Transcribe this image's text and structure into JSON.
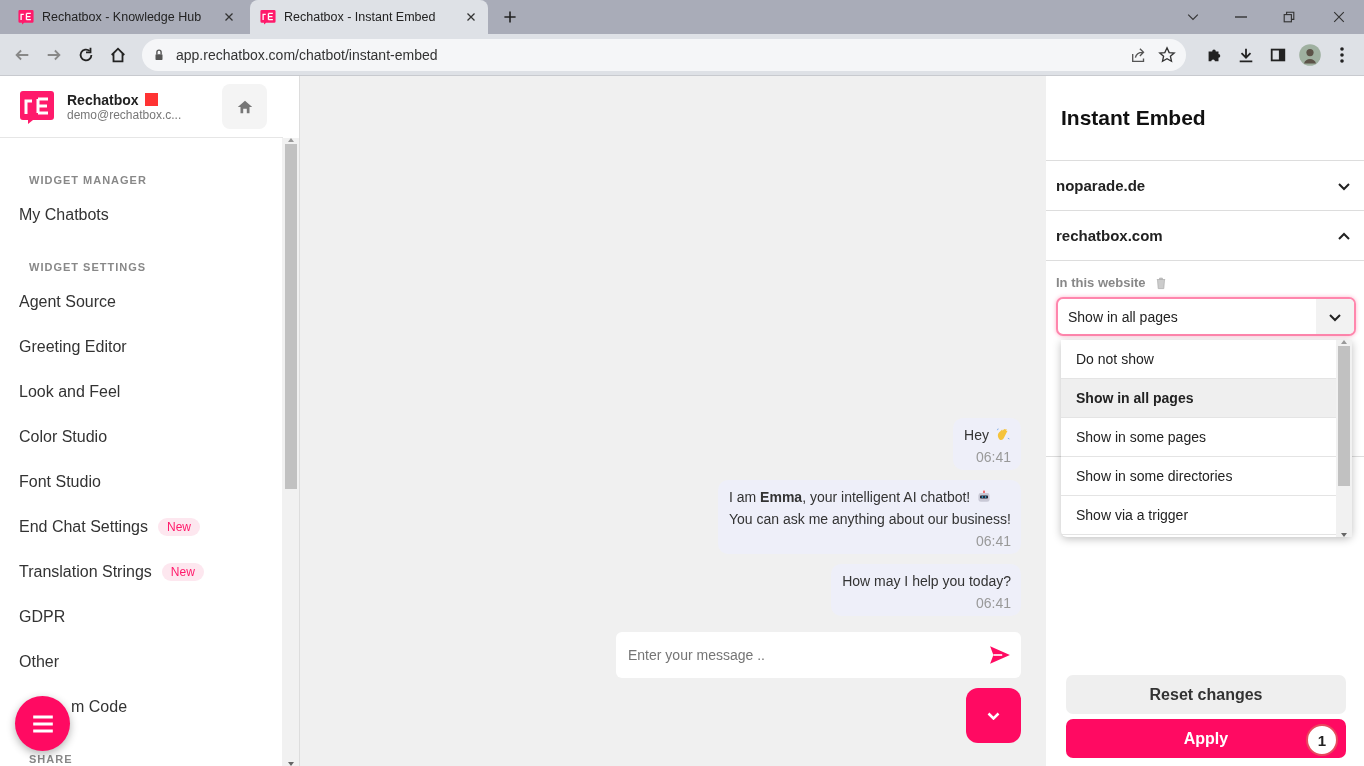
{
  "browser": {
    "tabs": [
      {
        "title": "Rechatbox - Knowledge Hub",
        "selected": false
      },
      {
        "title": "Rechatbox - Instant Embed",
        "selected": true
      }
    ],
    "address": "app.rechatbox.com/chatbot/instant-embed"
  },
  "sidebar": {
    "brand": {
      "name": "Rechatbox",
      "email": "demo@rechatbox.c..."
    },
    "sections": [
      {
        "heading": "WIDGET MANAGER",
        "items": [
          {
            "label": "My Chatbots"
          }
        ]
      },
      {
        "heading": "WIDGET SETTINGS",
        "items": [
          {
            "label": "Agent Source"
          },
          {
            "label": "Greeting Editor"
          },
          {
            "label": "Look and Feel"
          },
          {
            "label": "Color Studio"
          },
          {
            "label": "Font Studio"
          },
          {
            "label": "End Chat Settings",
            "badge": "New"
          },
          {
            "label": "Translation Strings",
            "badge": "New"
          },
          {
            "label": "GDPR"
          },
          {
            "label": "Other"
          },
          {
            "label": "m Code",
            "kind": "covered"
          }
        ]
      },
      {
        "heading": "SHARE"
      }
    ]
  },
  "chat": {
    "messages": [
      {
        "kind": "greeting",
        "lines": [
          "Hey"
        ],
        "time": "06:41"
      },
      {
        "kind": "introduction",
        "lines": [
          "I am **Emma**, your intelligent AI chatbot!",
          "You can ask me anything about our business!"
        ],
        "time": "06:41"
      },
      {
        "kind": "question",
        "lines": [
          "How may I help you today?"
        ],
        "time": "06:41"
      }
    ],
    "input": {
      "placeholder": "Enter your message .."
    }
  },
  "panel": {
    "title": "Instant Embed",
    "sites": [
      {
        "domain": "noparade.de",
        "expanded": false
      },
      {
        "domain": "rechatbox.com",
        "expanded": true
      }
    ],
    "field_label": "In this website",
    "select": {
      "value": "Show in all pages",
      "options": [
        {
          "label": "Do not show",
          "selected": false
        },
        {
          "label": "Show in all pages",
          "selected": true
        },
        {
          "label": "Show in some pages",
          "selected": false
        },
        {
          "label": "Show in some directories",
          "selected": false
        },
        {
          "label": "Show via a trigger",
          "selected": false
        }
      ]
    },
    "buttons": {
      "reset": "Reset changes",
      "apply": "Apply",
      "apply_badge": "1"
    }
  }
}
